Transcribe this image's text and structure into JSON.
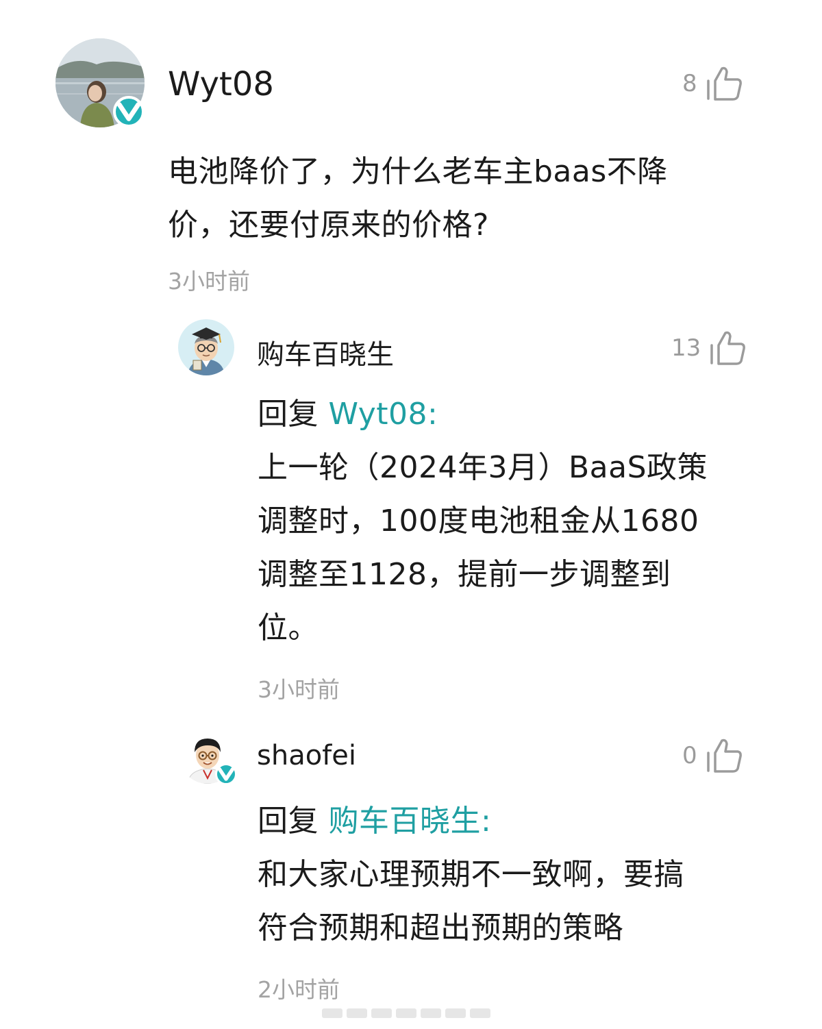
{
  "comment": {
    "user": "Wyt08",
    "verified": true,
    "likes": "8",
    "text_lines": [
      "电池降价了，为什么老车主baas不降",
      "价，还要付原来的价格?"
    ],
    "time": "3小时前"
  },
  "reply1": {
    "user": "购车百晓生",
    "likes": "13",
    "reply_prefix": "回复 ",
    "reply_to": "Wyt08:",
    "text_lines": [
      "上一轮（2024年3月）BaaS政策",
      "调整时，100度电池租金从1680",
      "调整至1128，提前一步调整到",
      "位。"
    ],
    "time": "3小时前"
  },
  "reply2": {
    "user": "shaofei",
    "verified": true,
    "likes": "0",
    "reply_prefix": "回复 ",
    "reply_to": "购车百晓生:",
    "text_lines": [
      "和大家心理预期不一致啊，要搞",
      "符合预期和超出预期的策略"
    ],
    "time": "2小时前"
  },
  "colors": {
    "accent": "#1f9fa2",
    "badge": "#22b3b8",
    "muted": "#a3a3a3"
  },
  "icons": {
    "like": "thumbs-up-icon",
    "verified": "verified-badge-icon"
  }
}
